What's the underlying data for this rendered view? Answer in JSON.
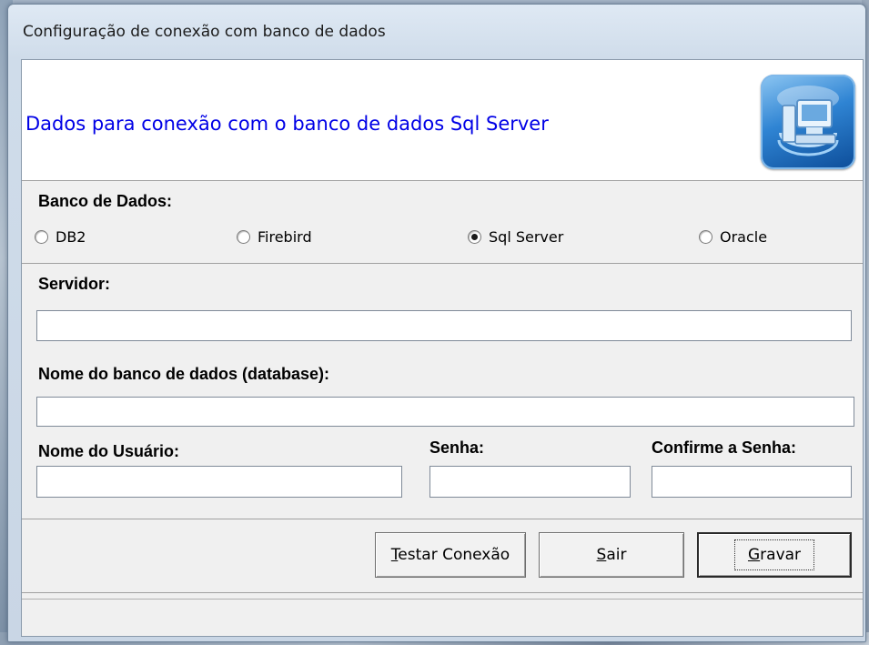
{
  "window": {
    "title": "Configuração de conexão com banco de dados"
  },
  "header": {
    "text": "Dados para conexão com o banco de dados Sql Server",
    "icon": "database-computer-icon",
    "text_color": "#0000e6"
  },
  "database": {
    "label": "Banco de Dados:",
    "options": [
      "DB2",
      "Firebird",
      "Sql Server",
      "Oracle"
    ],
    "selected": "Sql Server"
  },
  "form": {
    "server_label": "Servidor:",
    "server_value": "",
    "database_label": "Nome do banco de dados (database):",
    "database_value": "",
    "user_label": "Nome do Usuário:",
    "user_value": "",
    "password_label": "Senha:",
    "password_value": "",
    "confirm_label": "Confirme a Senha:",
    "confirm_value": ""
  },
  "buttons": {
    "test": {
      "label": "Testar Conexão",
      "mnemonic": "T",
      "rest": "estar Conexão"
    },
    "exit": {
      "label": "Sair",
      "mnemonic": "S",
      "rest": "air"
    },
    "save": {
      "label": "Gravar",
      "mnemonic": "G",
      "rest": "ravar"
    }
  }
}
